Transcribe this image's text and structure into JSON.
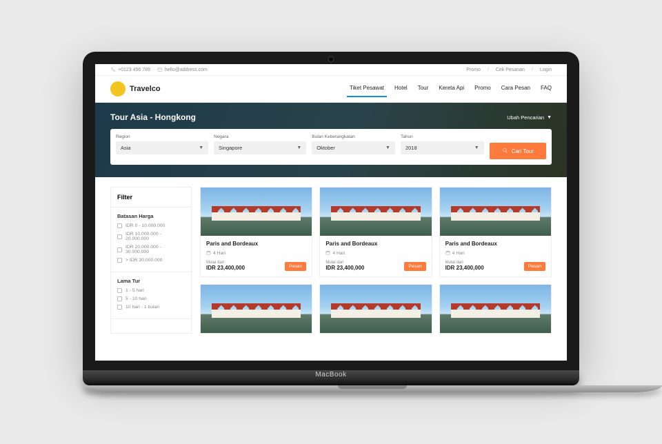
{
  "topbar": {
    "phone": "+0123 456 789",
    "email": "hello@address.com",
    "links": [
      "Promo",
      "Cek Pesanan",
      "Login"
    ]
  },
  "brand": {
    "name": "Travelco"
  },
  "nav": {
    "items": [
      {
        "label": "Tiket Pesawat",
        "active": true
      },
      {
        "label": "Hotel"
      },
      {
        "label": "Tour"
      },
      {
        "label": "Kereta Api"
      },
      {
        "label": "Promo"
      },
      {
        "label": "Cara Pesan"
      },
      {
        "label": "FAQ"
      }
    ]
  },
  "hero": {
    "title": "Tour Asia - Hongkong",
    "change_search": "Ubah Pencarian"
  },
  "search": {
    "region_label": "Region",
    "region_value": "Asia",
    "country_label": "Negara",
    "country_value": "Singapore",
    "month_label": "Bulan Keberangkatan",
    "month_value": "Oktober",
    "year_label": "Tahun",
    "year_value": "2018",
    "button": "Cari Tour"
  },
  "filter": {
    "title": "Filter",
    "price": {
      "title": "Batasan Harga",
      "options": [
        "IDR 0 - 10.000.000",
        "IDR 10.000.000 - 20.000.000",
        "IDR 20.000.000 - 30.000.000",
        "> IDR 30.000.000"
      ]
    },
    "duration": {
      "title": "Lama Tur",
      "options": [
        "1 - 5 hari",
        "5 - 10 hari",
        "10 hari - 1 bulan"
      ]
    }
  },
  "card": {
    "title": "Paris and Bordeaux",
    "duration": "4 Hari",
    "from_label": "Mulai dari",
    "price": "IDR 23,400,000",
    "cta": "Pesan"
  },
  "device": {
    "brand": "MacBook"
  }
}
